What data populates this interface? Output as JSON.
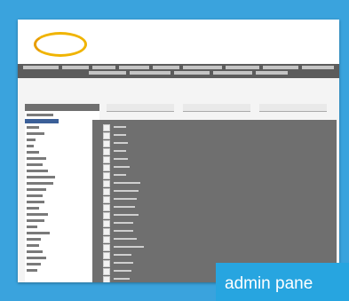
{
  "caption": {
    "text": "admin pane"
  },
  "colors": {
    "background": "#3aa3dd",
    "navbar": "#5c5c5c",
    "content_panel": "#6f6f6f",
    "caption_bg": "#27a5e0",
    "logo_ring": "#f0b400"
  },
  "icons": {
    "logo": "company-logo",
    "checkbox": "checkbox-icon"
  }
}
